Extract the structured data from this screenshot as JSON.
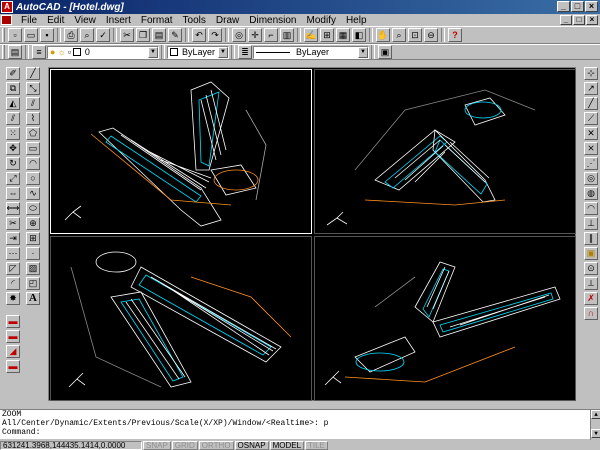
{
  "window": {
    "title": "AutoCAD - [Hotel.dwg]",
    "buttons": {
      "minimize": "_",
      "maximize": "□",
      "close": "×"
    }
  },
  "menu": {
    "items": [
      "File",
      "Edit",
      "View",
      "Insert",
      "Format",
      "Tools",
      "Draw",
      "Dimension",
      "Modify",
      "Help"
    ],
    "doc_buttons": {
      "minimize": "_",
      "restore": "□",
      "close": "×"
    }
  },
  "properties": {
    "layer_value": "0",
    "color_value": "ByLayer",
    "linetype_value": "ByLayer"
  },
  "command": {
    "lines": [
      "ZOOM",
      "All/Center/Dynamic/Extents/Previous/Scale(X/XP)/Window/<Realtime>: p",
      "Command:"
    ]
  },
  "status": {
    "coordinates": "631241.3968,144435.1414,0.0000",
    "toggles": [
      {
        "label": "SNAP",
        "on": false
      },
      {
        "label": "GRID",
        "on": false
      },
      {
        "label": "ORTHO",
        "on": false
      },
      {
        "label": "OSNAP",
        "on": true
      },
      {
        "label": "MODEL",
        "on": true
      },
      {
        "label": "TILE",
        "on": false
      }
    ]
  },
  "colors": {
    "model_background": "#000000",
    "title_gradient_start": "#0a246a",
    "wire_white": "#ffffff",
    "wire_cyan": "#00e0ff",
    "wire_orange": "#ff9020"
  }
}
